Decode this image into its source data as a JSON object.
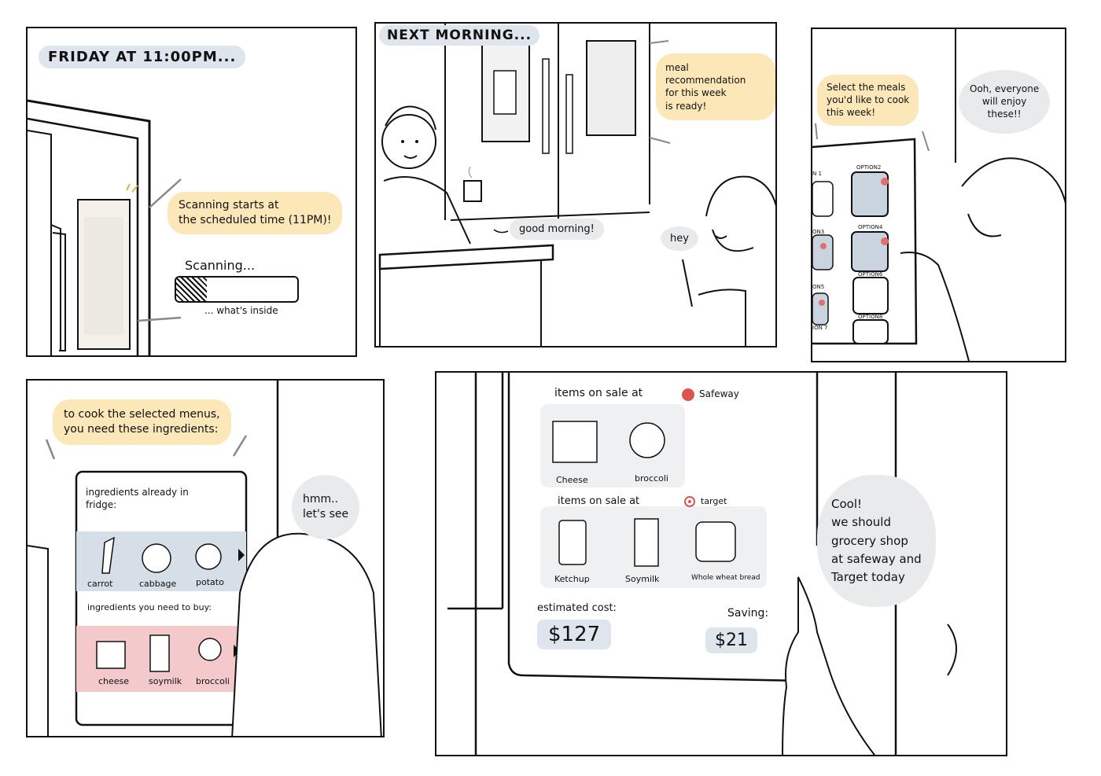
{
  "panel1": {
    "time_caption": "FRIDAY AT 11:00PM...",
    "bubble": "Scanning starts at\nthe scheduled time (11PM)!",
    "scanning_label": "Scanning...",
    "progress": 0.25,
    "progress_note": "... what's inside"
  },
  "panel2": {
    "time_caption": "NEXT MORNING...",
    "bubble": "meal recommendation\nfor this week\nis ready!",
    "man_speech": "good morning!",
    "woman_speech": "hey"
  },
  "panel3": {
    "bubble": "Select the meals\nyou'd like to cook\nthis week!",
    "woman_speech": "Ooh, everyone\nwill enjoy\nthese!!",
    "options": [
      "OPTION2",
      "OPTION4",
      "OPTION6",
      "OPTION8"
    ],
    "left_labels": [
      "N 1",
      "ON3",
      "ON5",
      "ION 7"
    ]
  },
  "panel4": {
    "bubble": "to cook the selected menus,\nyou need these ingredients:",
    "woman_speech": "hmm..\nlet's see",
    "already_title": "ingredients already in\nfridge:",
    "already_items": [
      "carrot",
      "cabbage",
      "potato"
    ],
    "buy_title": "ingredients you need to buy:",
    "buy_items": [
      "cheese",
      "soymilk",
      "broccoli"
    ]
  },
  "panel5": {
    "safeway_title": "items on sale at",
    "safeway_store": "Safeway",
    "safeway_items": [
      "Cheese",
      "broccoli"
    ],
    "target_title": "items on sale at",
    "target_store": "target",
    "target_items": [
      "Ketchup",
      "Soymilk",
      "Whole wheat bread"
    ],
    "cost_label": "estimated cost:",
    "cost_value": "$127",
    "saving_label": "Saving:",
    "saving_value": "$21",
    "speech": "Cool!\nwe should\ngrocery shop\nat safeway and\nTarget today"
  },
  "colors": {
    "yellow_highlight": "#fbe7b8",
    "blue_highlight": "#dfe5ec",
    "blue_row": "#d6dee8",
    "pink_row": "#f3c9cc",
    "grey_bubble": "#e9eaeb"
  }
}
